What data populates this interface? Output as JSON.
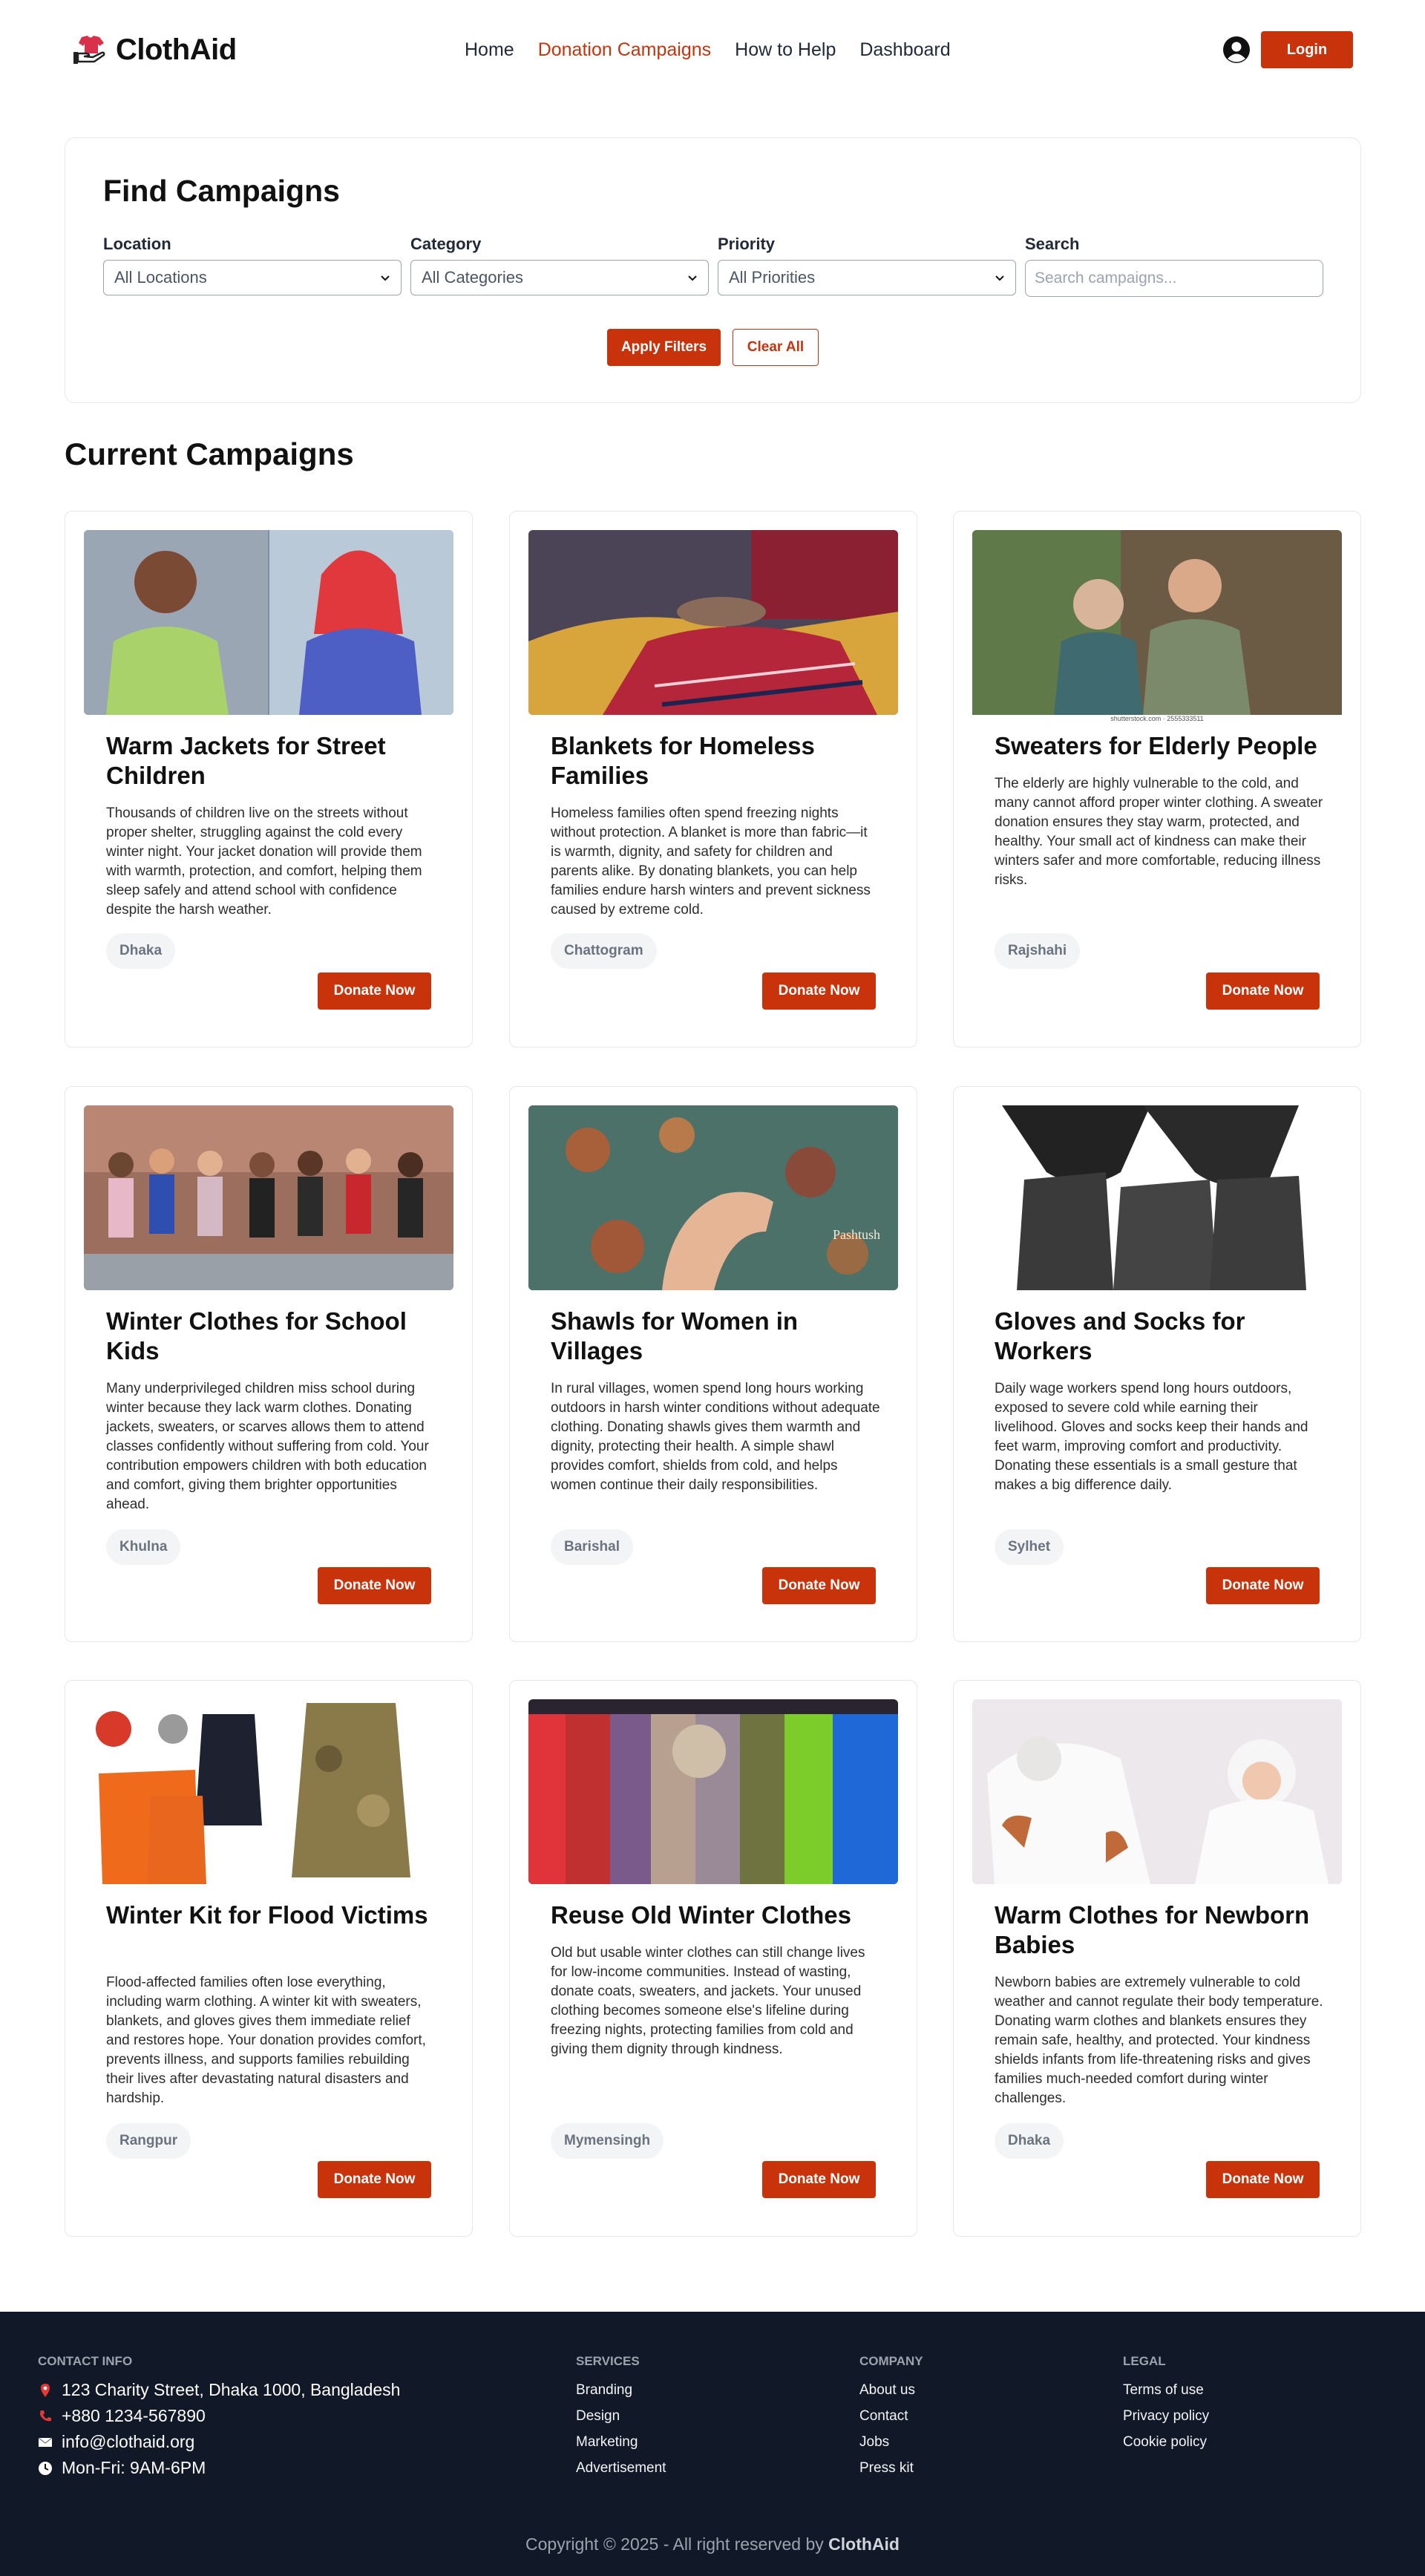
{
  "brand": {
    "name": "ClothAid",
    "accent": "#c8330c"
  },
  "nav": {
    "links": [
      "Home",
      "Donation Campaigns",
      "How to Help",
      "Dashboard"
    ],
    "active": "Donation Campaigns",
    "login_label": "Login"
  },
  "filters": {
    "title": "Find Campaigns",
    "location": {
      "label": "Location",
      "value": "All Locations"
    },
    "category": {
      "label": "Category",
      "value": "All Categories"
    },
    "priority": {
      "label": "Priority",
      "value": "All Priorities"
    },
    "search": {
      "label": "Search",
      "placeholder": "Search campaigns..."
    },
    "apply_label": "Apply Filters",
    "clear_label": "Clear All"
  },
  "campaigns_title": "Current Campaigns",
  "donate_label": "Donate Now",
  "campaigns": [
    {
      "title": "Warm Jackets for Street Children",
      "description": "Thousands of children live on the streets without proper shelter, struggling against the cold every winter night. Your jacket donation will provide them with warmth, protection, and comfort, helping them sleep safely and attend school with confidence despite the harsh weather.",
      "location": "Dhaka",
      "image": "children-jackets-photo"
    },
    {
      "title": "Blankets for Homeless Families",
      "description": "Homeless families often spend freezing nights without protection. A blanket is more than fabric—it is warmth, dignity, and safety for children and parents alike. By donating blankets, you can help families endure harsh winters and prevent sickness caused by extreme cold.",
      "location": "Chattogram",
      "image": "blanket-photo"
    },
    {
      "title": "Sweaters for Elderly People",
      "description": "The elderly are highly vulnerable to the cold, and many cannot afford proper winter clothing. A sweater donation ensures they stay warm, protected, and healthy. Your small act of kindness can make their winters safer and more comfortable, reducing illness risks.",
      "location": "Rajshahi",
      "image": "elderly-couple-photo",
      "image_caption": "shutterstock.com · 2555333511"
    },
    {
      "title": "Winter Clothes for School Kids",
      "description": "Many underprivileged children miss school during winter because they lack warm clothes. Donating jackets, sweaters, or scarves allows them to attend classes confidently without suffering from cold. Your contribution empowers children with both education and comfort, giving them brighter opportunities ahead.",
      "location": "Khulna",
      "image": "school-kids-photo"
    },
    {
      "title": "Shawls for Women in Villages",
      "description": "In rural villages, women spend long hours working outdoors in harsh winter conditions without adequate clothing. Donating shawls gives them warmth and dignity, protecting their health. A simple shawl provides comfort, shields from cold, and helps women continue their daily responsibilities.",
      "location": "Barishal",
      "image": "shawl-photo",
      "image_caption": "Pashtush"
    },
    {
      "title": "Gloves and Socks for Workers",
      "description": "Daily wage workers spend long hours outdoors, exposed to severe cold while earning their livelihood. Gloves and socks keep their hands and feet warm, improving comfort and productivity. Donating these essentials is a small gesture that makes a big difference daily.",
      "location": "Sylhet",
      "image": "socks-gloves-photo"
    },
    {
      "title": "Winter Kit for Flood Victims",
      "description": "Flood-affected families often lose everything, including warm clothing. A winter kit with sweaters, blankets, and gloves gives them immediate relief and restores hope. Your donation provides comfort, prevents illness, and supports families rebuilding their lives after devastating natural disasters and hardship.",
      "location": "Rangpur",
      "image": "winter-kit-photo"
    },
    {
      "title": "Reuse Old Winter Clothes",
      "description": "Old but usable winter clothes can still change lives for low-income communities. Instead of wasting, donate coats, sweaters, and jackets. Your unused clothing becomes someone else's lifeline during freezing nights, protecting families from cold and giving them dignity through kindness.",
      "location": "Mymensingh",
      "image": "coat-rack-photo"
    },
    {
      "title": "Warm Clothes for Newborn Babies",
      "description": "Newborn babies are extremely vulnerable to cold weather and cannot regulate their body temperature. Donating warm clothes and blankets ensures they remain safe, healthy, and protected. Your kindness shields infants from life-threatening risks and gives families much-needed comfort during winter challenges.",
      "location": "Dhaka",
      "image": "newborn-babies-photo"
    }
  ],
  "footer": {
    "contact_heading": "CONTACT INFO",
    "address": "123 Charity Street, Dhaka 1000, Bangladesh",
    "phone": "+880 1234-567890",
    "email": "info@clothaid.org",
    "hours": "Mon-Fri: 9AM-6PM",
    "services_heading": "SERVICES",
    "services": [
      "Branding",
      "Design",
      "Marketing",
      "Advertisement"
    ],
    "company_heading": "COMPANY",
    "company": [
      "About us",
      "Contact",
      "Jobs",
      "Press kit"
    ],
    "legal_heading": "LEGAL",
    "legal": [
      "Terms of use",
      "Privacy policy",
      "Cookie policy"
    ],
    "copyright_prefix": "Copyright © 2025 - All right reserved by",
    "copyright_brand": "ClothAid"
  }
}
